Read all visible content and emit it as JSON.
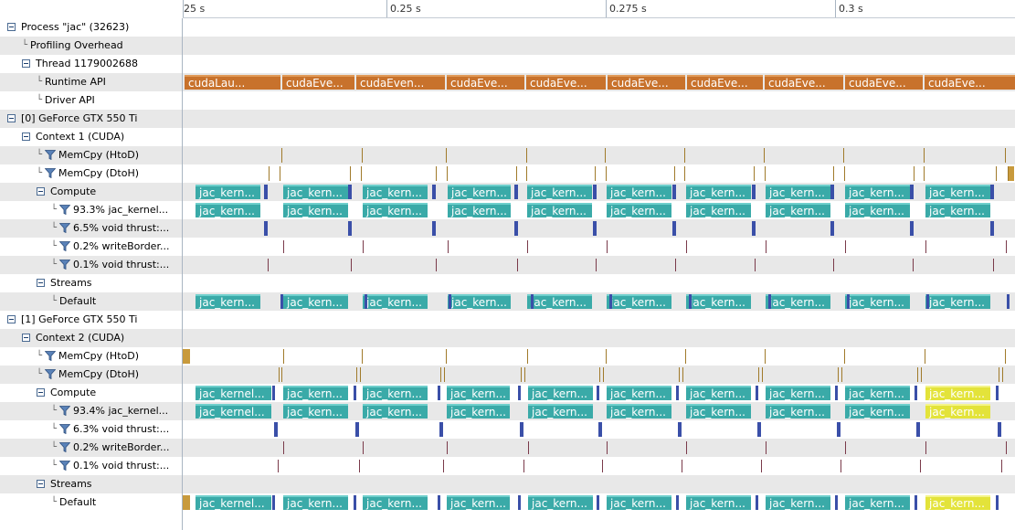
{
  "ruler": {
    "ticks": [
      "25 s",
      "0.25 s",
      "0.275 s",
      "0.3 s"
    ]
  },
  "tree": {
    "rows": [
      {
        "label": "Process \"jac\" (32623)",
        "indent": 0,
        "expander": true,
        "filter": false,
        "branch": false
      },
      {
        "label": "Profiling Overhead",
        "indent": 1,
        "expander": false,
        "filter": false,
        "branch": true
      },
      {
        "label": "Thread 1179002688",
        "indent": 1,
        "expander": true,
        "filter": false,
        "branch": false
      },
      {
        "label": "Runtime API",
        "indent": 2,
        "expander": false,
        "filter": false,
        "branch": true
      },
      {
        "label": "Driver API",
        "indent": 2,
        "expander": false,
        "filter": false,
        "branch": true
      },
      {
        "label": "[0] GeForce GTX 550 Ti",
        "indent": 0,
        "expander": true,
        "filter": false,
        "branch": false
      },
      {
        "label": "Context 1 (CUDA)",
        "indent": 1,
        "expander": true,
        "filter": false,
        "branch": false
      },
      {
        "label": "MemCpy (HtoD)",
        "indent": 2,
        "expander": false,
        "filter": true,
        "branch": true
      },
      {
        "label": "MemCpy (DtoH)",
        "indent": 2,
        "expander": false,
        "filter": true,
        "branch": true
      },
      {
        "label": "Compute",
        "indent": 2,
        "expander": true,
        "filter": false,
        "branch": false
      },
      {
        "label": "93.3% jac_kernel...",
        "indent": 3,
        "expander": false,
        "filter": true,
        "branch": true
      },
      {
        "label": "6.5% void thrust:...",
        "indent": 3,
        "expander": false,
        "filter": true,
        "branch": true
      },
      {
        "label": "0.2% writeBorder...",
        "indent": 3,
        "expander": false,
        "filter": true,
        "branch": true
      },
      {
        "label": "0.1% void thrust:...",
        "indent": 3,
        "expander": false,
        "filter": true,
        "branch": true
      },
      {
        "label": "Streams",
        "indent": 2,
        "expander": true,
        "filter": false,
        "branch": false
      },
      {
        "label": "Default",
        "indent": 3,
        "expander": false,
        "filter": false,
        "branch": true
      },
      {
        "label": "[1] GeForce GTX 550 Ti",
        "indent": 0,
        "expander": true,
        "filter": false,
        "branch": false
      },
      {
        "label": "Context 2 (CUDA)",
        "indent": 1,
        "expander": true,
        "filter": false,
        "branch": false
      },
      {
        "label": "MemCpy (HtoD)",
        "indent": 2,
        "expander": false,
        "filter": true,
        "branch": true
      },
      {
        "label": "MemCpy (DtoH)",
        "indent": 2,
        "expander": false,
        "filter": true,
        "branch": true
      },
      {
        "label": "Compute",
        "indent": 2,
        "expander": true,
        "filter": false,
        "branch": false
      },
      {
        "label": "93.4% jac_kernel...",
        "indent": 3,
        "expander": false,
        "filter": true,
        "branch": true
      },
      {
        "label": "6.3% void thrust:...",
        "indent": 3,
        "expander": false,
        "filter": true,
        "branch": true
      },
      {
        "label": "0.2% writeBorder...",
        "indent": 3,
        "expander": false,
        "filter": true,
        "branch": true
      },
      {
        "label": "0.1% void thrust:...",
        "indent": 3,
        "expander": false,
        "filter": true,
        "branch": true
      },
      {
        "label": "Streams",
        "indent": 2,
        "expander": true,
        "filter": false,
        "branch": false
      },
      {
        "label": "Default",
        "indent": 3,
        "expander": false,
        "filter": false,
        "branch": true
      }
    ]
  },
  "timeline": {
    "runtime_api_labels": [
      "cudaLau...",
      "cudaEve...",
      "cudaEven...",
      "cudaEve...",
      "cudaEve...",
      "cudaEve...",
      "cudaEve...",
      "cudaEve...",
      "cudaEve...",
      "cudaEve..."
    ],
    "gpu0_kernel_labels": [
      "jac_kern...",
      "jac_kern...",
      "jac_kern...",
      "jac_kern...",
      "jac_kern...",
      "jac_kern...",
      "jac_kern...",
      "jac_kern...",
      "jac_kern...",
      "jac_kern..."
    ],
    "gpu1_kernel_labels": [
      "jac_kernel...",
      "jac_kern...",
      "jac_kern...",
      "jac_kern...",
      "jac_kern...",
      "jac_kern...",
      "jac_kern...",
      "jac_kern...",
      "jac_kern...",
      "jac_kern..."
    ]
  },
  "colors": {
    "runtime_api": "#c8722c",
    "kernel": "#3aaaa8",
    "kernel_selected": "#e3e33a",
    "thrust": "#3a4fa8",
    "memcpy": "#c89a3c",
    "row_alt": "#e8e8e8",
    "expander_border": "#4a6a92"
  },
  "icons": {
    "expander": "collapse-minus-icon",
    "filter": "funnel-filter-icon"
  }
}
